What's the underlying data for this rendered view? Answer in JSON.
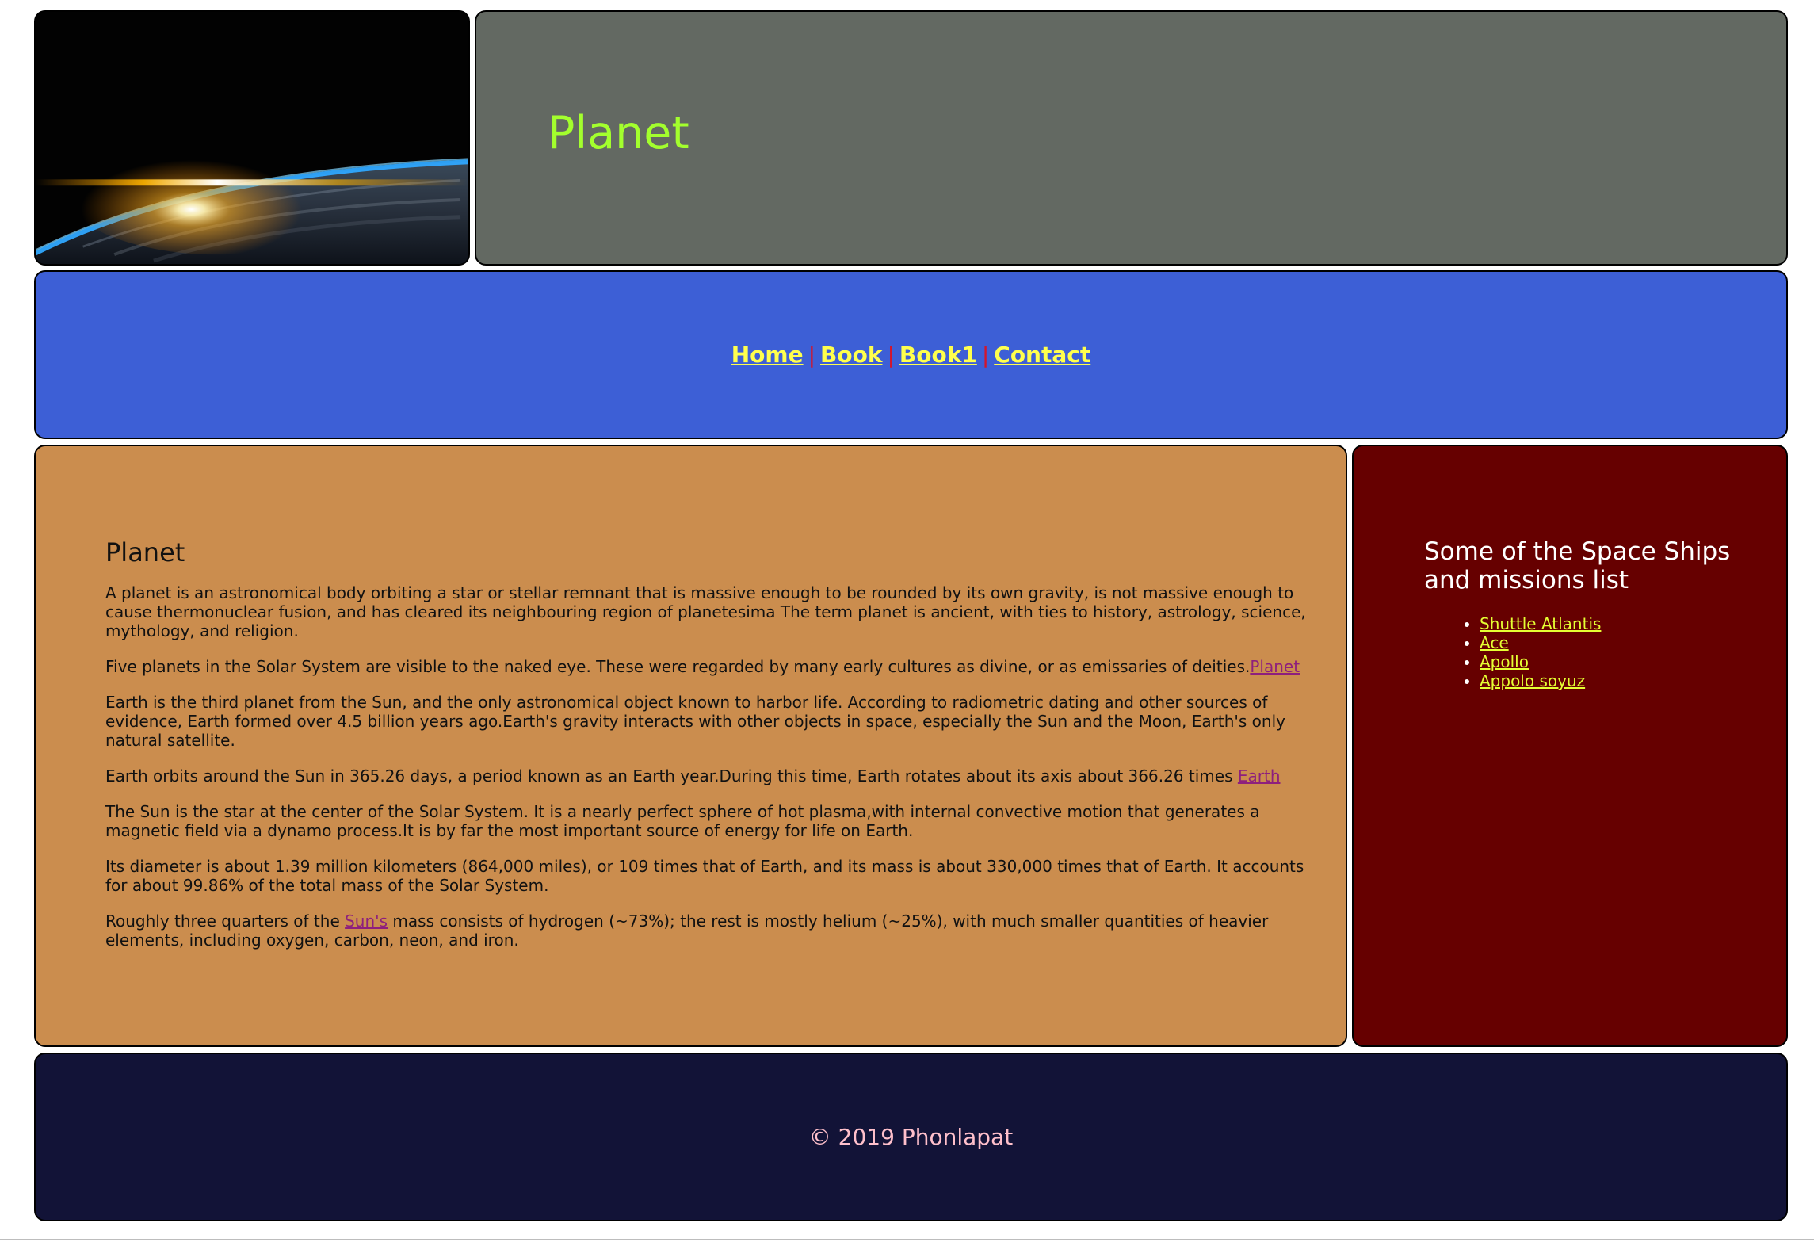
{
  "header": {
    "image_alt": "Earth sunrise from space",
    "title": "Planet"
  },
  "nav": {
    "home": "Home",
    "book": "Book",
    "book1": "Book1",
    "contact": "Contact",
    "separator": "|"
  },
  "main": {
    "heading": "Planet",
    "p1": "A planet is an astronomical body orbiting a star or stellar remnant that is massive enough to be rounded by its own gravity, is not massive enough to cause thermonuclear fusion, and has cleared its neighbouring region of planetesima The term planet is ancient, with ties to history, astrology, science, mythology, and religion.",
    "p2_text": "Five planets in the Solar System are visible to the naked eye. These were regarded by many early cultures as divine, or as emissaries of deities.",
    "p2_link": "Planet",
    "p3": "Earth is the third planet from the Sun, and the only astronomical object known to harbor life. According to radiometric dating and other sources of evidence, Earth formed over 4.5 billion years ago.Earth's gravity interacts with other objects in space, especially the Sun and the Moon, Earth's only natural satellite.",
    "p4_text": "Earth orbits around the Sun in 365.26 days, a period known as an Earth year.During this time, Earth rotates about its axis about 366.26 times ",
    "p4_link": "Earth",
    "p5": "The Sun is the star at the center of the Solar System. It is a nearly perfect sphere of hot plasma,with internal convective motion that generates a magnetic field via a dynamo process.It is by far the most important source of energy for life on Earth.",
    "p6": "Its diameter is about 1.39 million kilometers (864,000 miles), or 109 times that of Earth, and its mass is about 330,000 times that of Earth. It accounts for about 99.86% of the total mass of the Solar System.",
    "p7_before": "Roughly three quarters of the ",
    "p7_link": "Sun's",
    "p7_after": " mass consists of hydrogen (~73%); the rest is mostly helium (~25%), with much smaller quantities of heavier elements, including oxygen, carbon, neon, and iron."
  },
  "sidebar": {
    "heading": "Some of the Space Ships and missions list",
    "items": [
      {
        "label": "Shuttle Atlantis"
      },
      {
        "label": "Ace"
      },
      {
        "label": "Apollo"
      },
      {
        "label": "Appolo soyuz"
      }
    ]
  },
  "footer": {
    "text": "© 2019 Phonlapat"
  },
  "colors": {
    "title_panel": "#636962",
    "title_text": "#a3ff2d",
    "nav_bg": "#3d5fd6",
    "nav_link": "#ffff4d",
    "nav_separator": "#d4142b",
    "main_bg": "#cb8d4e",
    "main_link": "#8e1f7d",
    "sidebar_bg": "#660000",
    "sidebar_link": "#e5ff33",
    "footer_bg": "#121337",
    "footer_text": "#ffc0cb"
  }
}
